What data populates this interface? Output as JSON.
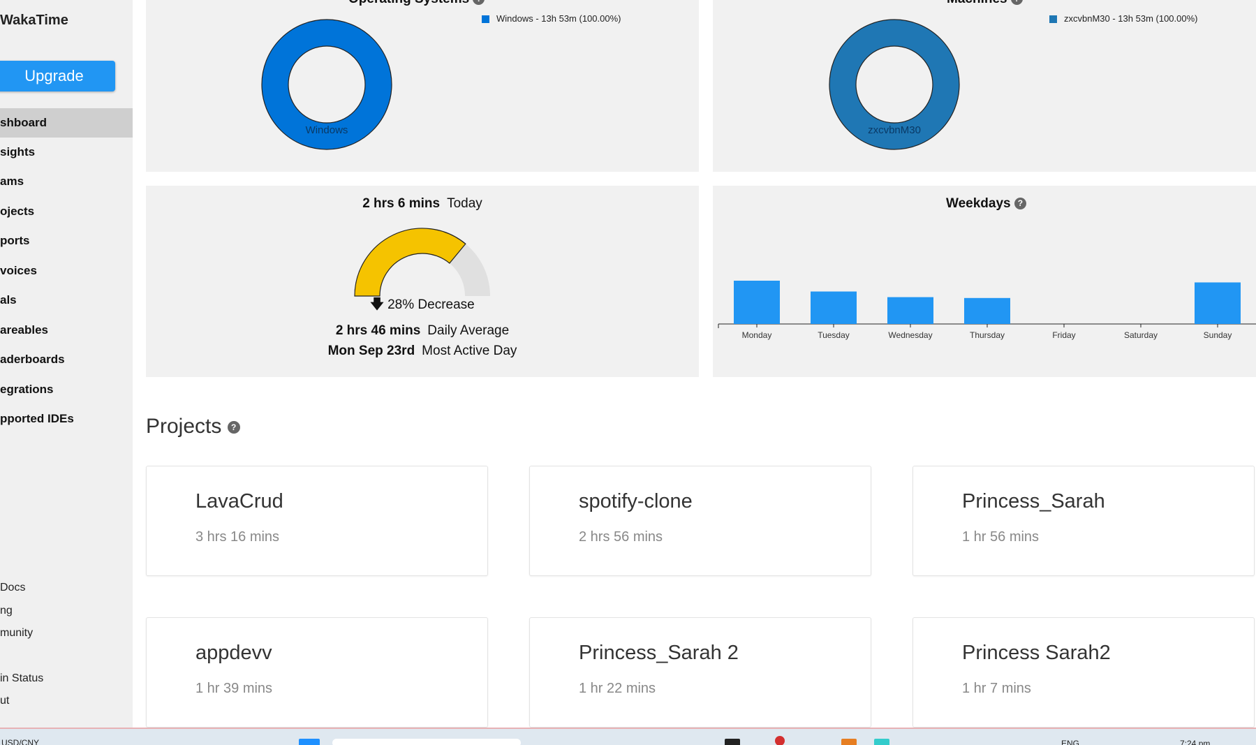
{
  "sidebar": {
    "brand": "WakaTime",
    "upgrade_label": "Upgrade",
    "items": [
      {
        "label": "shboard",
        "active": true
      },
      {
        "label": "sights"
      },
      {
        "label": "ams"
      },
      {
        "label": "ojects"
      },
      {
        "label": "ports"
      },
      {
        "label": "voices"
      },
      {
        "label": "als"
      },
      {
        "label": "areables"
      },
      {
        "label": "aderboards"
      },
      {
        "label": "egrations"
      },
      {
        "label": "pported IDEs"
      }
    ],
    "footer": [
      "Docs",
      "ng",
      "munity",
      "in Status",
      "ut"
    ]
  },
  "os_panel": {
    "title": "Operating Systems",
    "legend": "Windows - 13h 53m (100.00%)",
    "donut_label": "Windows",
    "color": "#0074d9",
    "percent": 100
  },
  "machines_panel": {
    "title": "Machines",
    "legend": "zxcvbnM30 - 13h 53m (100.00%)",
    "donut_label": "zxcvbnM30",
    "color": "#1f77b4",
    "percent": 100
  },
  "today_panel": {
    "today_value": "2 hrs 6 mins",
    "today_label": "Today",
    "change_icon": "arrow-down-icon",
    "change_text": "28% Decrease",
    "daily_avg_value": "2 hrs 46 mins",
    "daily_avg_label": "Daily Average",
    "most_active_value": "Mon Sep 23rd",
    "most_active_label": "Most Active Day",
    "gauge_fraction": 0.72,
    "gauge_color": "#f5c300",
    "gauge_track_color": "#e0e0e0"
  },
  "weekdays_panel": {
    "title": "Weekdays"
  },
  "chart_data": {
    "type": "bar",
    "title": "Weekdays",
    "categories": [
      "Monday",
      "Tuesday",
      "Wednesday",
      "Thursday",
      "Friday",
      "Saturday",
      "Sunday"
    ],
    "values": [
      1.0,
      0.75,
      0.62,
      0.6,
      0,
      0,
      0.96
    ],
    "color": "#2196f3",
    "grid": false
  },
  "projects": {
    "heading": "Projects",
    "items": [
      {
        "name": "LavaCrud",
        "time": "3 hrs 16 mins"
      },
      {
        "name": "spotify-clone",
        "time": "2 hrs 56 mins"
      },
      {
        "name": "Princess_Sarah",
        "time": "1 hr 56 mins"
      },
      {
        "name": "appdevv",
        "time": "1 hr 39 mins"
      },
      {
        "name": "Princess_Sarah 2",
        "time": "1 hr 22 mins"
      },
      {
        "name": "Princess Sarah2",
        "time": "1 hr 7 mins"
      }
    ]
  },
  "taskbar": {
    "ticker": "USD/CNY",
    "lang": "ENG",
    "time": "7:24 pm",
    "notification_count": "1"
  }
}
